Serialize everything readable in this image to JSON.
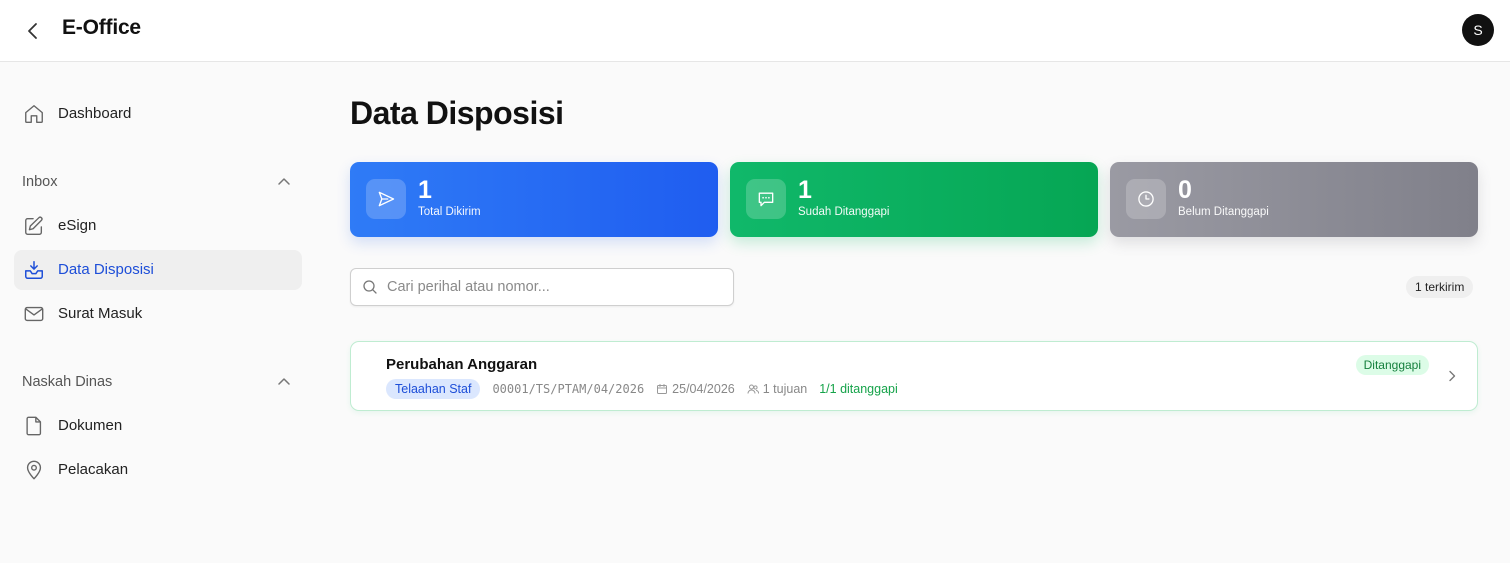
{
  "header": {
    "title": "E-Office",
    "avatar_initial": "S"
  },
  "sidebar": {
    "dashboard": {
      "label": "Dashboard",
      "icon": "home-icon"
    },
    "sections": [
      {
        "title": "Inbox",
        "items": [
          {
            "label": "eSign",
            "icon": "pen-square-icon"
          },
          {
            "label": "Data Disposisi",
            "icon": "inbox-icon",
            "active": true
          },
          {
            "label": "Surat Masuk",
            "icon": "mail-icon"
          }
        ]
      },
      {
        "title": "Naskah Dinas",
        "items": [
          {
            "label": "Dokumen",
            "icon": "file-icon"
          },
          {
            "label": "Pelacakan",
            "icon": "map-pin-icon"
          }
        ]
      }
    ]
  },
  "main": {
    "page_title": "Data Disposisi",
    "stats": [
      {
        "value": "1",
        "label": "Total Dikirim",
        "icon": "send-icon",
        "color": "#2563eb"
      },
      {
        "value": "1",
        "label": "Sudah Ditanggapi",
        "icon": "message-icon",
        "color": "#10b981"
      },
      {
        "value": "0",
        "label": "Belum Ditanggapi",
        "icon": "clock-icon",
        "color": "#8b8b94"
      }
    ],
    "search": {
      "placeholder": "Cari perihal atau nomor...",
      "value": ""
    },
    "count_badge": "1 terkirim",
    "items": [
      {
        "subject": "Perubahan Anggaran",
        "type": "Telaahan Staf",
        "number": "00001/TS/PTAM/04/2026",
        "date": "25/04/2026",
        "recipients": "1 tujuan",
        "responses": "1/1 ditanggapi",
        "status": "Ditanggapi"
      }
    ]
  }
}
